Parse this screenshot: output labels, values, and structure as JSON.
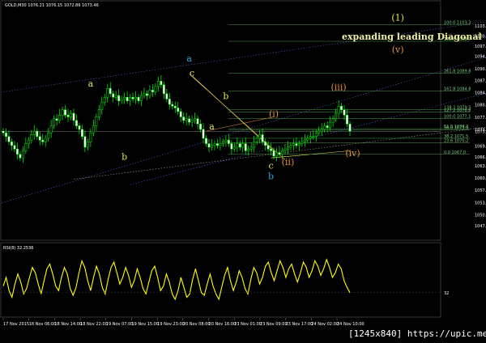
{
  "header": {
    "symbol_line": "GOLD,M30 1076.21 1076.15 1072.86 1073.46"
  },
  "rsi_label": "RSI(8) 32.2536",
  "watermark": "[1245x840] https://upic.me/",
  "headline": "expanding leading Diagonal",
  "colors": {
    "bull": "#00ff00",
    "bear": "#00ff00",
    "rsi": "#ffff00",
    "accent_orange": "#e8903a",
    "accent_blue": "#29a9e0",
    "accent_yellow": "#e6e65a",
    "grid": "#3a3a3a"
  },
  "chart_data": {
    "type": "candlestick",
    "symbol": "GOLD",
    "timeframe": "M30",
    "price_axis": {
      "ylim": [
        1044.5,
        1108.0
      ],
      "ticks": [
        "1103.05",
        "1100.20",
        "1097.35",
        "1094.50",
        "1090.95",
        "1087.75",
        "1084.30",
        "1080.85",
        "1077.40",
        "1073.95",
        "1073.46",
        "1069.35",
        "1066.25",
        "1063.80",
        "1060.35",
        "1057.00",
        "1053.45",
        "1050.00",
        "1047.00"
      ]
    },
    "time_axis": {
      "ticks": [
        "17 Nov 2015",
        "18 Nov 06:00",
        "18 Nov 14:00",
        "18 Nov 22:00",
        "19 Nov 07:00",
        "19 Nov 15:00",
        "19 Nov 23:00",
        "20 Nov 08:00",
        "20 Nov 16:00",
        "23 Nov 01:00",
        "23 Nov 09:00",
        "23 Nov 17:00",
        "24 Nov 02:00",
        "24 Nov 10:00"
      ]
    },
    "fib_levels": [
      "100.0 1103.3",
      "161.8 1098.7",
      "261.8 1089.8",
      "161.8 1084.8",
      "138.2 1079.5",
      "127.2 1078.8",
      "100.0 1077.1",
      "61.8 1074.2",
      "50.0 1073.9",
      "38.2 1071.5",
      "23.6 1070.2",
      "0.0 1067.0"
    ],
    "close_series": [
      1073.0,
      1072.0,
      1070.5,
      1069.5,
      1068.5,
      1067.0,
      1066.0,
      1068.0,
      1070.0,
      1071.0,
      1072.5,
      1073.5,
      1072.0,
      1071.0,
      1070.5,
      1071.5,
      1073.0,
      1075.0,
      1077.0,
      1076.5,
      1078.0,
      1079.5,
      1078.0,
      1077.5,
      1078.5,
      1076.5,
      1075.0,
      1074.0,
      1072.0,
      1069.0,
      1070.5,
      1073.0,
      1075.0,
      1077.5,
      1079.5,
      1081.5,
      1083.0,
      1085.5,
      1084.0,
      1083.0,
      1083.5,
      1082.0,
      1082.5,
      1083.0,
      1082.0,
      1083.0,
      1082.5,
      1083.0,
      1082.0,
      1083.5,
      1084.0,
      1083.5,
      1085.0,
      1084.5,
      1086.0,
      1087.5,
      1086.5,
      1084.0,
      1082.5,
      1081.0,
      1080.5,
      1080.0,
      1079.0,
      1077.5,
      1076.5,
      1077.0,
      1076.0,
      1076.5,
      1077.0,
      1075.5,
      1074.0,
      1071.5,
      1070.0,
      1069.0,
      1069.5,
      1070.0,
      1069.5,
      1070.0,
      1070.5,
      1071.0,
      1070.0,
      1068.5,
      1069.0,
      1070.0,
      1069.0,
      1070.0,
      1068.0,
      1068.5,
      1069.0,
      1070.5,
      1071.5,
      1072.5,
      1070.5,
      1069.5,
      1068.5,
      1068.0,
      1066.5,
      1067.5,
      1067.0,
      1068.0,
      1068.5,
      1069.0,
      1069.5,
      1070.0,
      1069.5,
      1070.0,
      1070.5,
      1071.0,
      1071.5,
      1072.0,
      1072.0,
      1073.0,
      1073.5,
      1074.0,
      1075.0,
      1074.5,
      1076.0,
      1077.0,
      1078.5,
      1080.5,
      1079.5,
      1078.0,
      1075.5,
      1073.5
    ],
    "indicator": {
      "name": "RSI(8)",
      "last": 32.2536,
      "ylim": [
        0,
        100
      ],
      "level_labels": [
        "32"
      ],
      "values": [
        42,
        55,
        35,
        25,
        45,
        60,
        48,
        30,
        38,
        55,
        70,
        62,
        45,
        30,
        50,
        68,
        75,
        60,
        42,
        35,
        55,
        70,
        60,
        38,
        28,
        40,
        62,
        80,
        70,
        50,
        35,
        55,
        72,
        60,
        40,
        30,
        52,
        70,
        78,
        62,
        45,
        55,
        70,
        58,
        40,
        50,
        68,
        55,
        38,
        30,
        48,
        65,
        72,
        55,
        35,
        42,
        60,
        48,
        30,
        22,
        35,
        55,
        40,
        25,
        30,
        52,
        68,
        50,
        32,
        28,
        45,
        60,
        42,
        30,
        22,
        40,
        58,
        70,
        50,
        35,
        48,
        65,
        55,
        38,
        30,
        52,
        70,
        62,
        45,
        55,
        72,
        78,
        62,
        50,
        65,
        80,
        70,
        55,
        68,
        75,
        60,
        48,
        62,
        78,
        70,
        55,
        65,
        80,
        72,
        58,
        68,
        82,
        70,
        55,
        62,
        75,
        68,
        50,
        40,
        32
      ]
    },
    "wave_labels": [
      {
        "text": "a",
        "color": "#29a9e0",
        "price": 1093.0,
        "bar": 66
      },
      {
        "text": "c",
        "color": "#e6e65a",
        "price": 1089.0,
        "bar": 67
      },
      {
        "text": "a",
        "color": "#e6e65a",
        "price": 1086.0,
        "bar": 31
      },
      {
        "text": "b",
        "color": "#e6e65a",
        "price": 1065.5,
        "bar": 43
      },
      {
        "text": "b",
        "color": "#e6e65a",
        "price": 1082.5,
        "bar": 79
      },
      {
        "text": "a",
        "color": "#e6e65a",
        "price": 1074.0,
        "bar": 74
      },
      {
        "text": "c",
        "color": "#e6e65a",
        "price": 1063.0,
        "bar": 95
      },
      {
        "text": "b",
        "color": "#29a9e0",
        "price": 1060.0,
        "bar": 95
      },
      {
        "text": "(i)",
        "color": "#e8903a",
        "price": 1077.5,
        "bar": 96
      },
      {
        "text": "(ii)",
        "color": "#e8903a",
        "price": 1064.0,
        "bar": 101
      },
      {
        "text": "(iii)",
        "color": "#e8903a",
        "price": 1085.0,
        "bar": 119
      },
      {
        "text": "(iv)",
        "color": "#e8903a",
        "price": 1066.5,
        "bar": 124
      },
      {
        "text": "(v)",
        "color": "#e8903a",
        "price": 1095.5,
        "bar": 140
      },
      {
        "text": "(1)",
        "color": "#e6e65a",
        "price": 1104.5,
        "bar": 140
      }
    ]
  }
}
